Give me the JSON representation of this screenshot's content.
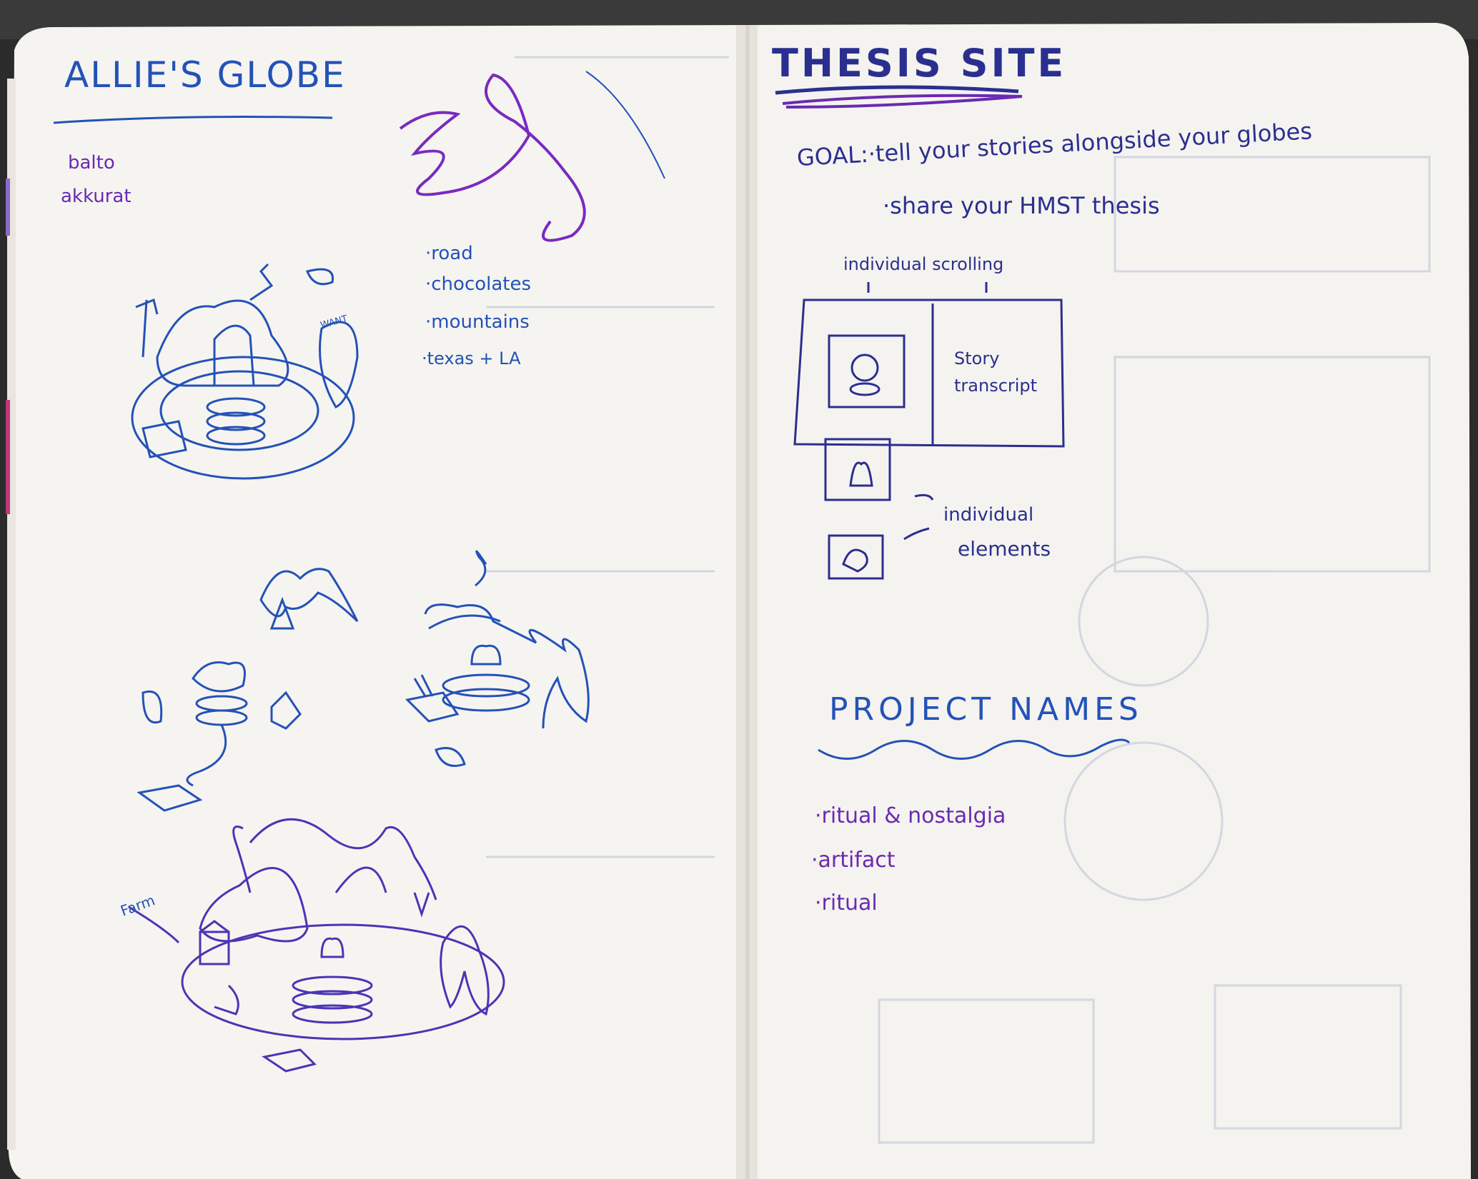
{
  "left_page": {
    "title": "ALLIE'S GLOBE",
    "font_notes": [
      "balto",
      "akkurat"
    ],
    "list_items": [
      "·road",
      "·chocolates",
      "·mountains",
      "·texas + LA"
    ],
    "farm_label": "Farm",
    "sign_text": "WANT"
  },
  "right_page": {
    "title": "THESIS SITE",
    "goal_line_1": "GOAL:·tell your stories alongside your globes",
    "goal_line_2": "·share your HMST thesis",
    "scroll_label": "individual scrolling",
    "story_label_1": "Story",
    "story_label_2": "transcript",
    "elements_label_1": "individual",
    "elements_label_2": "elements",
    "project_names_heading": "PROJECT NAMES",
    "project_names": [
      "·ritual & nostalgia",
      "·artifact",
      "·ritual"
    ]
  },
  "colors": {
    "paper": "#f4f2ee",
    "blue_ink": "#2352b8",
    "purple_ink": "#6a2ab3",
    "navy_ink": "#2a2f8f",
    "binding": "#2b2b2b"
  }
}
